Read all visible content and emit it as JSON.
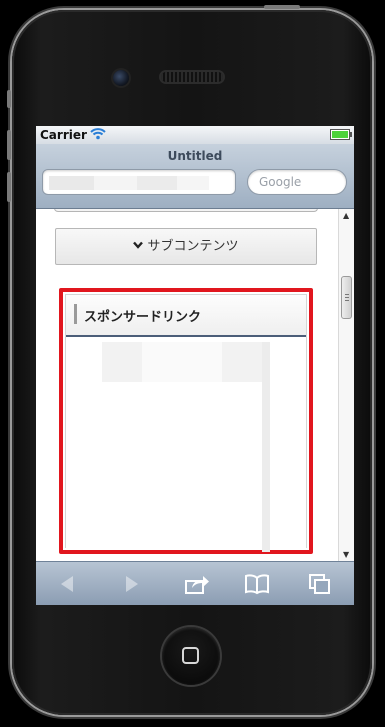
{
  "status_bar": {
    "carrier": "Carrier"
  },
  "browser": {
    "page_title": "Untitled",
    "search_placeholder": "Google"
  },
  "page": {
    "subcontent_button_label": "サブコンテンツ",
    "sponsored_heading": "スポンサードリンク"
  },
  "toolbar": {
    "icons": [
      "back-icon",
      "forward-icon",
      "share-icon",
      "bookmarks-icon",
      "tabs-icon"
    ],
    "back_enabled": false,
    "forward_enabled": false
  },
  "colors": {
    "highlight_border": "#e1161e",
    "nav_gradient_top": "#c6d1dd",
    "nav_gradient_bottom": "#9eafc2",
    "heading_underline": "#4b5d78"
  }
}
